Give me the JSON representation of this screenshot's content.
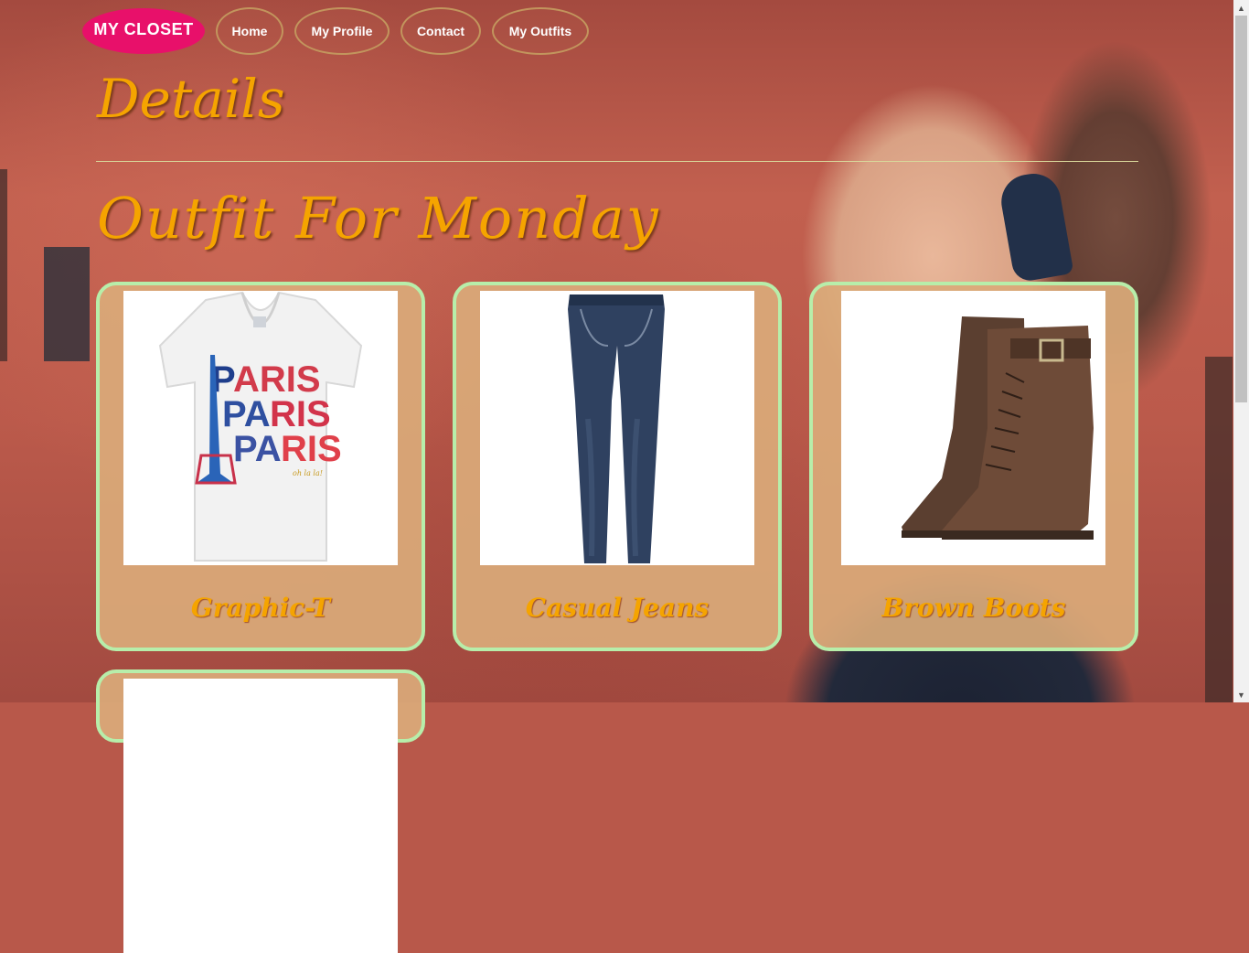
{
  "nav": {
    "brand": "MY CLOSET",
    "items": [
      {
        "label": "Home"
      },
      {
        "label": "My Profile"
      },
      {
        "label": "Contact"
      },
      {
        "label": "My Outfits"
      }
    ]
  },
  "page": {
    "title": "Details",
    "subtitle": "Outfit For Monday"
  },
  "items": [
    {
      "name": "Graphic-T",
      "image": "white v-neck t-shirt with PARIS print"
    },
    {
      "name": "Casual Jeans",
      "image": "dark wash skinny jeans"
    },
    {
      "name": "Brown Boots",
      "image": "brown lace-up leather boots"
    },
    {
      "name": "",
      "image": "partially visible item"
    }
  ],
  "colors": {
    "brand": "#e8106a",
    "title": "#f5a400",
    "card_border": "#b7eeaa",
    "card_bg": "#daaa7a",
    "nav_border": "#c2955d"
  }
}
